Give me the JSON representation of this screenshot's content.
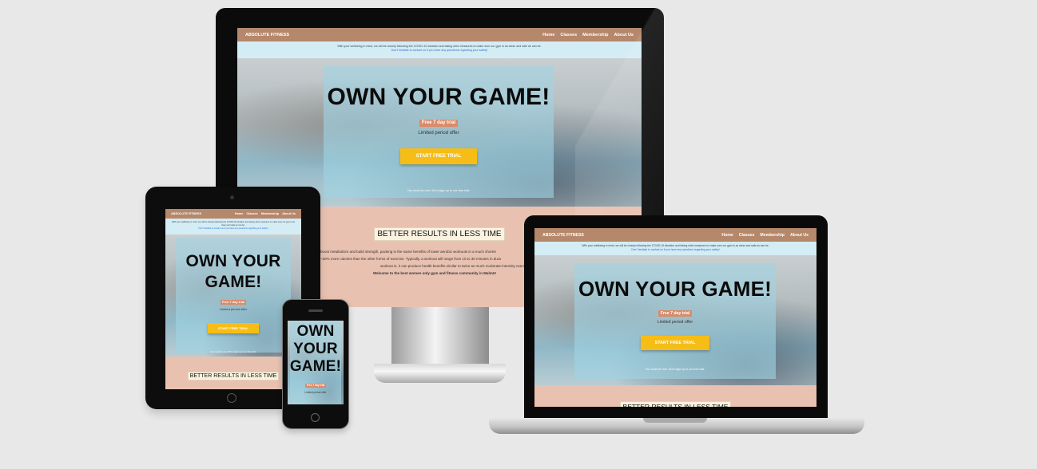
{
  "site": {
    "brand": "ABSOLUTE FITNESS",
    "nav": [
      "Home",
      "Classes",
      "Membership",
      "About Us"
    ],
    "notice_line1": "With your wellbeing in mind, we will be closely following the COVID-19 situation and taking strict measures to make sure our gym is as clean and safe as can be.",
    "notice_line2": "Don't hesitate to contact us if you have any questions regarding your safety!",
    "hero_title": "OWN YOUR GAME!",
    "hero_title_tablet_1": "OWN YOUR",
    "hero_title_tablet_2": "GAME!",
    "hero_title_phone_1": "OWN",
    "hero_title_phone_2": "YOUR",
    "hero_title_phone_3": "GAME!",
    "trial_badge": "Free 7 day trial",
    "trial_sub": "Limited period offer",
    "cta": "START FREE TRIAL",
    "age_note": "You must be over 18 to sign up to our free trial.",
    "section_title": "BETTER RESULTS IN LESS TIME",
    "body_line1": "boost metabolism and build strength, packing in the same benefits of lower aerobic workouts in a much shorter",
    "body_line2": "~30% more calories than the other forms of exercise. Typically, a workout will range from 10 to 30 minutes in dura",
    "body_line3": "workout is, it can produce health benefits similar to twice as much moderate-intensity exercise",
    "body_line4": "Welcome to the best women only gym and fitness community in Malmö!"
  },
  "colors": {
    "nav": "#b5876b",
    "notice": "#d4ecf4",
    "cta": "#f6bd16",
    "badge": "#d98b6a",
    "section_bg": "#e9c1b1"
  }
}
